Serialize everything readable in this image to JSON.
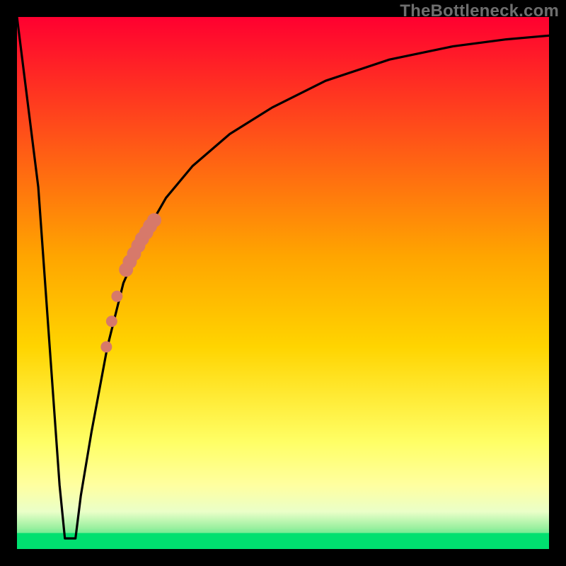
{
  "watermark": "TheBottleneck.com",
  "colors": {
    "frame": "#000000",
    "curve": "#000000",
    "marker": "#d7796a",
    "gradient_stops": [
      {
        "offset": 0,
        "color": "#ff0030"
      },
      {
        "offset": 0.45,
        "color": "#ffa500"
      },
      {
        "offset": 0.62,
        "color": "#ffd400"
      },
      {
        "offset": 0.8,
        "color": "#ffff66"
      },
      {
        "offset": 0.88,
        "color": "#ffffa0"
      },
      {
        "offset": 0.93,
        "color": "#eaffc8"
      },
      {
        "offset": 0.96,
        "color": "#9bf0a0"
      },
      {
        "offset": 1,
        "color": "#00e070"
      }
    ]
  },
  "chart_data": {
    "type": "line",
    "title": "",
    "xlabel": "",
    "ylabel": "",
    "xlim": [
      0,
      100
    ],
    "ylim": [
      0,
      100
    ],
    "series": [
      {
        "name": "curve",
        "x": [
          0,
          4,
          8,
          9,
          10,
          11,
          12,
          14,
          17,
          20,
          24,
          28,
          33,
          40,
          48,
          58,
          70,
          82,
          92,
          100
        ],
        "y": [
          100,
          68,
          12,
          2,
          2,
          2,
          10,
          22,
          38,
          50,
          59,
          66,
          72,
          78,
          83,
          88,
          92,
          94.5,
          95.8,
          96.5
        ]
      }
    ],
    "markers": [
      {
        "x": 20.5,
        "y": 52.5,
        "r": 10
      },
      {
        "x": 21.2,
        "y": 54.0,
        "r": 10
      },
      {
        "x": 22.0,
        "y": 55.5,
        "r": 10
      },
      {
        "x": 22.8,
        "y": 57.0,
        "r": 10
      },
      {
        "x": 23.5,
        "y": 58.3,
        "r": 10
      },
      {
        "x": 24.3,
        "y": 59.5,
        "r": 10
      },
      {
        "x": 25.0,
        "y": 60.7,
        "r": 10
      },
      {
        "x": 25.8,
        "y": 61.8,
        "r": 10
      },
      {
        "x": 18.8,
        "y": 47.5,
        "r": 8
      },
      {
        "x": 17.8,
        "y": 42.8,
        "r": 8
      },
      {
        "x": 16.8,
        "y": 38.0,
        "r": 8
      }
    ],
    "floor_band": {
      "y0": 0,
      "y1": 3
    }
  }
}
